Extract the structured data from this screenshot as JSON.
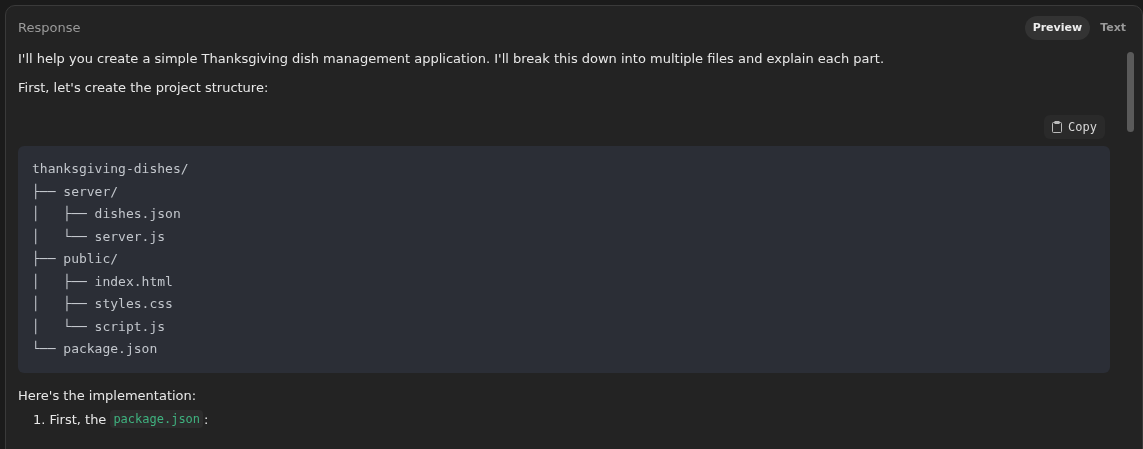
{
  "header": {
    "title": "Response",
    "tabs": [
      {
        "label": "Preview",
        "selected": true
      },
      {
        "label": "Text",
        "selected": false
      }
    ]
  },
  "paragraphs": [
    "I'll help you create a simple Thanksgiving dish management application. I'll break this down into multiple files and explain each part.",
    "First, let's create the project structure:"
  ],
  "code_block": {
    "copy_label": "Copy",
    "lines": [
      "thanksgiving-dishes/",
      "├── server/",
      "│   ├── dishes.json",
      "│   └── server.js",
      "├── public/",
      "│   ├── index.html",
      "│   ├── styles.css",
      "│   └── script.js",
      "└── package.json"
    ]
  },
  "after_text": "Here's the implementation:",
  "list": [
    {
      "marker": "1.",
      "text": "First, the",
      "code": "package.json",
      "suffix": ":"
    }
  ]
}
